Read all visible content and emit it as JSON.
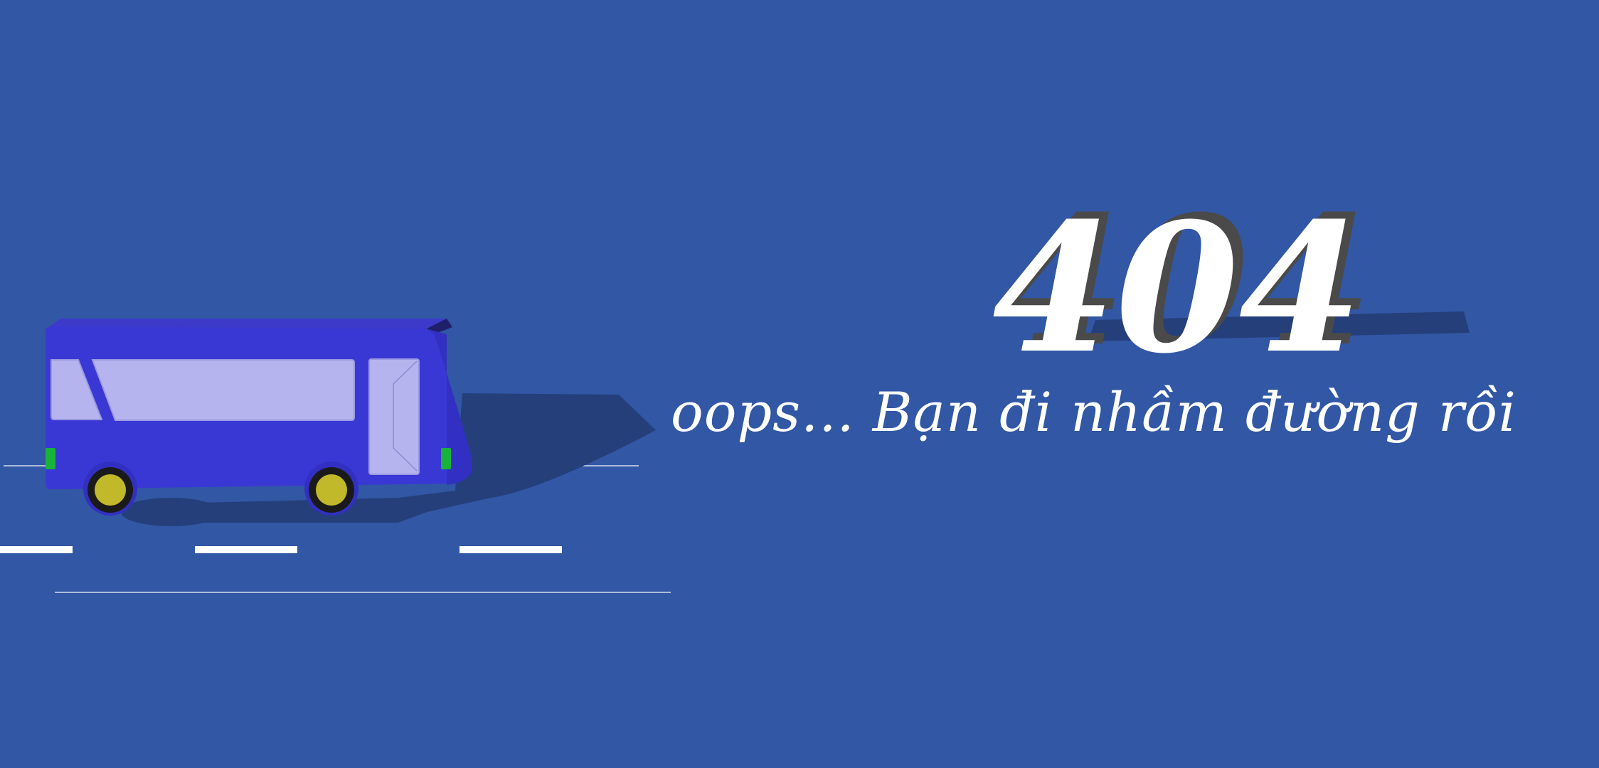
{
  "error_page": {
    "code": "404",
    "message": "oops... Bạn đi nhầm đường rồi"
  },
  "colors": {
    "background": "#3157a5",
    "bus_body": "#3a38d4",
    "bus_window": "#b5b4ee",
    "bus_shadow": "#253f7a",
    "wheel_rim": "#c1b92a",
    "wheel_tire": "#1a1a1a",
    "light": "#19b33a",
    "road_line": "#ffffff",
    "text": "#ffffff",
    "text_shadow": "#4a4a4a"
  },
  "icons": [
    "bus-icon",
    "wheel-icon",
    "road-icon"
  ]
}
